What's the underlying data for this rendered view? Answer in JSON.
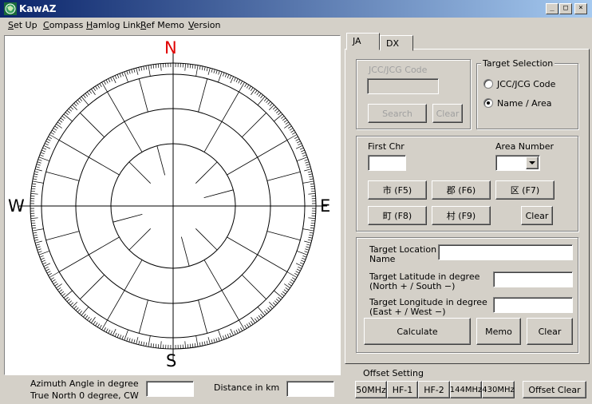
{
  "window": {
    "title": "KawAZ",
    "controls": {
      "minimize": "_",
      "maximize": "□",
      "close": "×"
    }
  },
  "menu": {
    "items": [
      {
        "pre": "",
        "key": "S",
        "post": "et Up"
      },
      {
        "pre": "",
        "key": "C",
        "post": "ompass"
      },
      {
        "pre": "",
        "key": "H",
        "post": "amlog Link"
      },
      {
        "pre": "",
        "key": "R",
        "post": "ef Memo"
      },
      {
        "pre": "",
        "key": "V",
        "post": "ersion"
      }
    ]
  },
  "compass": {
    "north": "N",
    "south": "S",
    "east": "E",
    "west": "W",
    "north_color": "#e00000"
  },
  "bottom": {
    "azimuth_line1": "Azimuth Angle in degree",
    "azimuth_line2": "True North 0 degree, CW",
    "azimuth_value": "",
    "distance_label": "Distance in km",
    "distance_value": ""
  },
  "tabs": {
    "ja": "JA",
    "dx": "DX"
  },
  "code_group": {
    "label": "JCC/JCG Code",
    "value": "",
    "search": "Search",
    "clear": "Clear"
  },
  "target_selection": {
    "title": "Target Selection",
    "option1": "JCC/JCG Code",
    "option2": "Name / Area",
    "selected": "option2"
  },
  "chr_group": {
    "first_chr_label": "First Chr",
    "first_chr_value": "",
    "area_number_label": "Area Number",
    "area_number_value": "",
    "btn_shi": "市 (F5)",
    "btn_gun": "郡 (F6)",
    "btn_ku": "区 (F7)",
    "btn_machi": "町 (F8)",
    "btn_mura": "村 (F9)",
    "clear": "Clear"
  },
  "target_group": {
    "location_l1": "Target Location",
    "location_l2": "Name",
    "location_value": "",
    "lat_l1": "Target Latitude in degree",
    "lat_l2": "(North + / South −)",
    "lat_value": "",
    "lon_l1": "Target Longitude in degree",
    "lon_l2": "(East + / West −)",
    "lon_value": "",
    "calculate": "Calculate",
    "memo": "Memo",
    "clear": "Clear"
  },
  "offset": {
    "title": "Offset Setting",
    "b50": "50MHz",
    "hf1": "HF-1",
    "hf2": "HF-2",
    "b144": "144MHz",
    "b430": "430MHz",
    "clear": "Offset Clear"
  }
}
